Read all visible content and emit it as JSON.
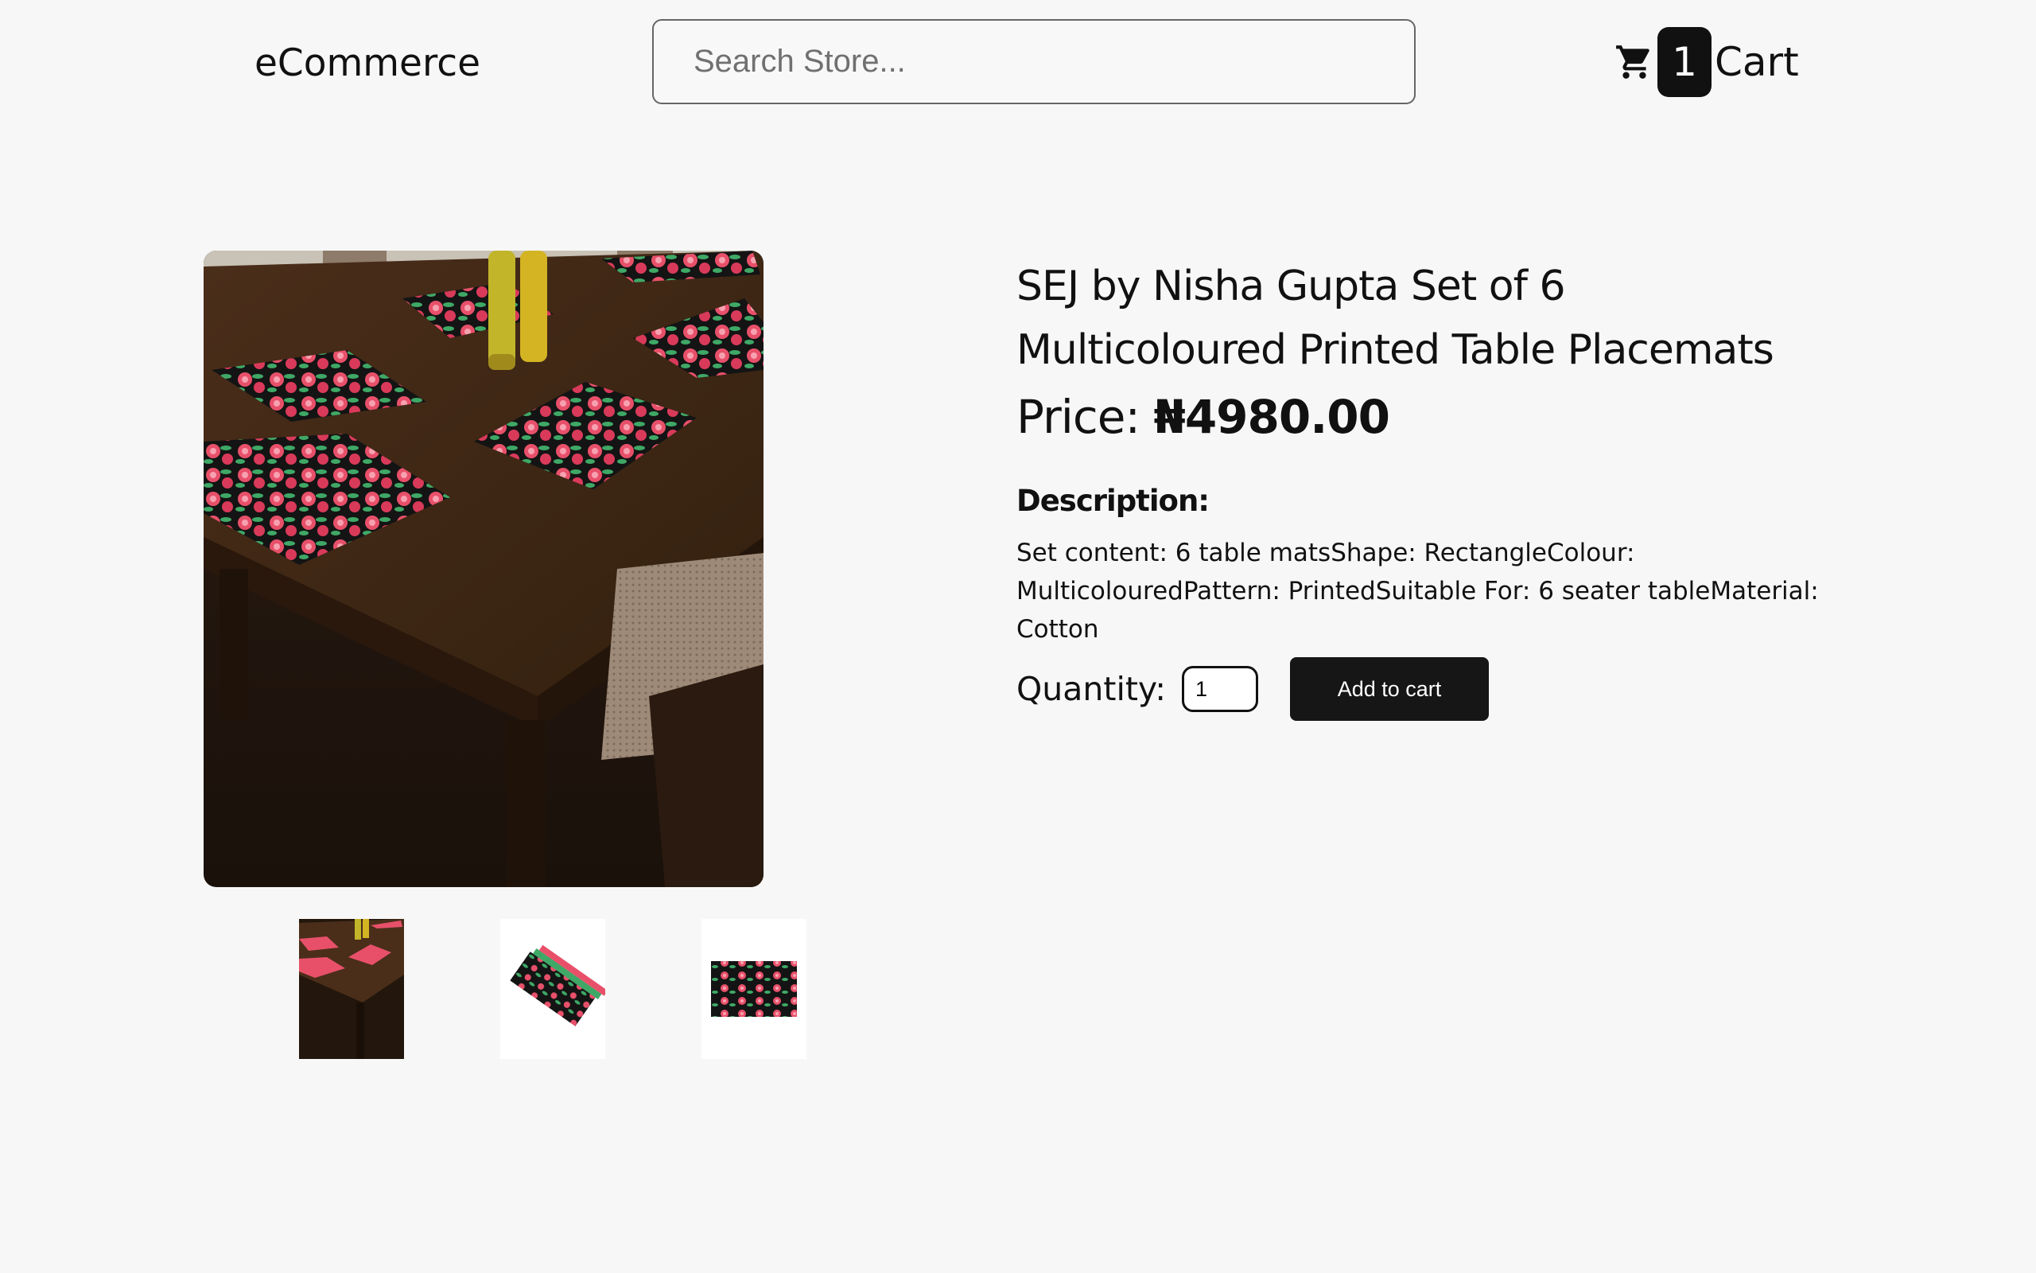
{
  "header": {
    "logo": "eCommerce",
    "search_placeholder": "Search Store...",
    "cart_count": "1",
    "cart_label": "Cart"
  },
  "product": {
    "title": "SEJ by Nisha Gupta Set of 6 Multicoloured Printed Table Placemats",
    "price_label": "Price:",
    "price_value": "₦4980.00",
    "description_heading": "Description:",
    "description": "Set content: 6 table matsShape: RectangleColour: MulticolouredPattern: PrintedSuitable For: 6 seater tableMaterial: Cotton",
    "quantity_label": "Quantity:",
    "quantity_value": "1",
    "add_to_cart_label": "Add to cart"
  },
  "icons": {
    "cart": "cart-icon"
  },
  "colors": {
    "background": "#f7f7f7",
    "button": "#161616",
    "table_wood": "#3a2415",
    "mat_black": "#141414",
    "flower_pink": "#e8506a",
    "leaf_green": "#3fa866"
  }
}
